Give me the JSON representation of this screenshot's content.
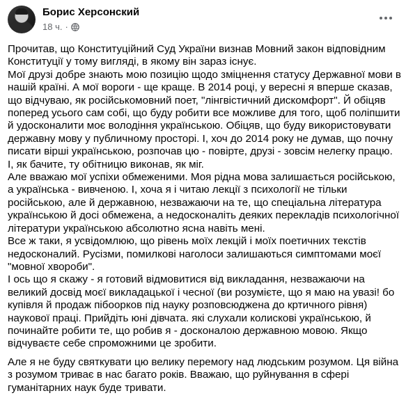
{
  "post": {
    "author": "Борис Херсонский",
    "time": "18 ч.",
    "separator": "·",
    "privacy_icon": "globe-icon",
    "more_icon": "more-horizontal-icon"
  },
  "paragraphs": [
    "Прочитав, що Конституційний Суд України визнав Мовний закон відповідним Конституції у тому вигляді, в якому він зараз існує.",
    "Мої друзі добре знають мою позицію щодо зміцнення статусу Державної мови в нашій країні. А мої вороги - ще краще. В 2014 році, у вересні я вперше сказав, що відчуваю, як російськомовний поет, \"лінгвістичний дискомфорт\". Й обіцяв поперед усього сам собі, що буду робити все можливе для того, щоб поліпшити й удосконалити моє володіння українською. Обіцяв, що буду використовувати державну мову у публичному просторі. І, хоч до 2014 року не думав, що почну писати вірші українською, розпочав цю - повірте, друзі - зовсім нелегку працю. І, як бачите, ту обітницю виконав, як міг.",
    "Але вважаю мої успіхи обмеженими. Моя рідна мова залишається російською, а українська - вивченою. І, хоча я і читаю лекції з психології не тільки російською, але й державною, незважаючи на те, що спеціальна література українською й досі обмежена, а недосконаліть деяких перекладів психологічної літератури українською абсолютно ясна навіть мені.",
    "Все ж таки, я усвідомлюю, що рівень моїх лекцій і моїх поетичних текстів недосконалий. Русізми, помилкові наголоси залишаються симптомами моєї \"мовної хвороби\".",
    "І ось що я скажу - я готовий відмовитися від викладання, незважаючи на великий досвід моєї викладацької і чесної (ви розумієте, що я маю на увазі! бо купівля й продаж пібоорков під науку розповсюджена до кртичного рівня) наукової праці. Прийдіть юні дівчата. які слухали колискові українською, й починайте робити те, що робив я - досконалою державною мовою. Якщо відчуваєте себе спроможними це зробити.",
    "Але я не буду святкувати цю велику перемогу над людським розумом. Ця війна з розумом триває в нас багато років. Вважаю, що руйнування  в сфері гуманітарних наук буде тривати."
  ]
}
